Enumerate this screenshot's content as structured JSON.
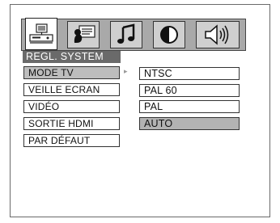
{
  "tabs": [
    {
      "icon": "system-setup-icon",
      "active": true
    },
    {
      "icon": "language-speech-icon",
      "active": false
    },
    {
      "icon": "music-note-icon",
      "active": false
    },
    {
      "icon": "contrast-icon",
      "active": false
    },
    {
      "icon": "speaker-icon",
      "active": false
    }
  ],
  "menu": {
    "title": "REGL. SYSTEM",
    "items": [
      {
        "label": "MODE TV"
      },
      {
        "label": "VEILLE ECRAN"
      },
      {
        "label": "VIDÉO"
      },
      {
        "label": "SORTIE HDMI"
      },
      {
        "label": "PAR DÉFAUT"
      }
    ],
    "selected_item": "MODE TV"
  },
  "submenu": {
    "options": [
      {
        "label": "NTSC"
      },
      {
        "label": "PAL 60"
      },
      {
        "label": "PAL"
      },
      {
        "label": "AUTO"
      }
    ],
    "highlighted_option": "AUTO"
  },
  "colors": {
    "heading_bg": "#6a6a6a",
    "selected_bg": "#bdbdbd",
    "highlight_bg": "#b3b3b3",
    "tabbar_bg": "#a9a9a9"
  }
}
